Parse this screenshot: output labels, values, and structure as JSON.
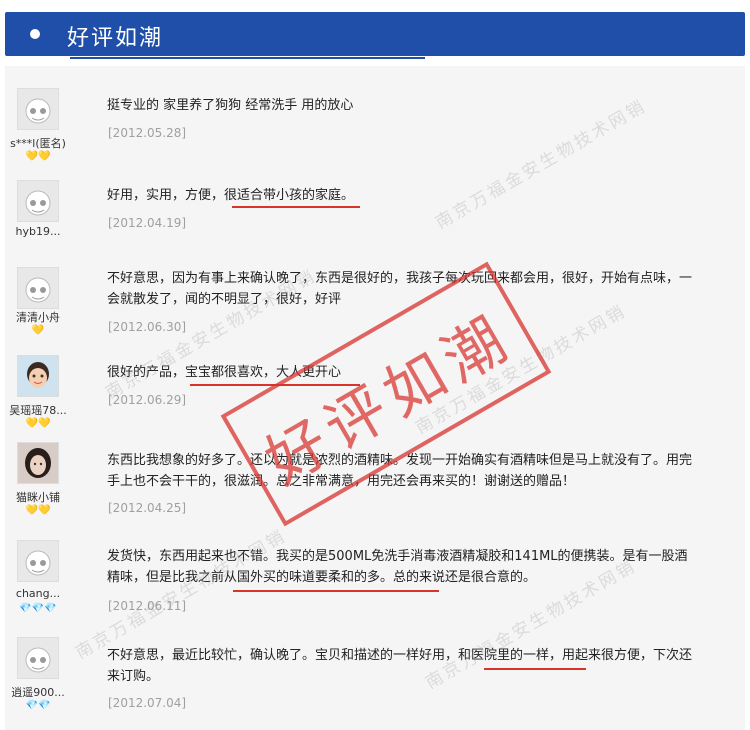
{
  "header": {
    "title": "好评如潮"
  },
  "reviews": [
    {
      "user": "s***l(匿名)",
      "badge_type": "gold",
      "badges": "💛💛",
      "text": "挺专业的 家里养了狗狗 经常洗手 用的放心",
      "date": "[2012.05.28]"
    },
    {
      "user": "hyb19...",
      "badge_type": "none",
      "badges": "",
      "text": "好用，实用，方便，很适合带小孩的家庭。",
      "date": "[2012.04.19]"
    },
    {
      "user": "清清小舟",
      "badge_type": "gold",
      "badges": "💛",
      "text": "不好意思，因为有事上来确认晚了，东西是很好的，我孩子每次玩回来都会用，很好，开始有点味，一会就散发了，闻的不明显了，很好，好评",
      "date": "[2012.06.30]"
    },
    {
      "user": "吴瑶瑶78...",
      "badge_type": "gold",
      "badges": "💛💛",
      "text": "很好的产品，宝宝都很喜欢，大人更开心",
      "date": "[2012.06.29]"
    },
    {
      "user": "猫眯小铺",
      "badge_type": "gold",
      "badges": "💛💛",
      "text": "东西比我想象的好多了。还以为就是浓烈的酒精味。发现一开始确实有酒精味但是马上就没有了。用完手上也不会干干的，很滋润。总之非常满意，用完还会再来买的！谢谢送的赠品！",
      "date": "[2012.04.25]"
    },
    {
      "user": "chang...",
      "badge_type": "red",
      "badges": "💎💎💎",
      "text": "发货快，东西用起来也不错。我买的是500ML免洗手消毒液酒精凝胶和141ML的便携装。是有一股酒精味，但是比我之前从国外买的味道要柔和的多。总的来说还是很合意的。",
      "date": "[2012.06.11]"
    },
    {
      "user": "逍遥900...",
      "badge_type": "red",
      "badges": "💎💎",
      "text": "不好意思，最近比较忙，确认晚了。宝贝和描述的一样好用，和医院里的一样，用起来很方便，下次还来订购。",
      "date": "[2012.07.04]"
    }
  ],
  "stamp": {
    "text": "好评如潮"
  },
  "watermark": {
    "text": "南京万福金安生物技术网销"
  }
}
